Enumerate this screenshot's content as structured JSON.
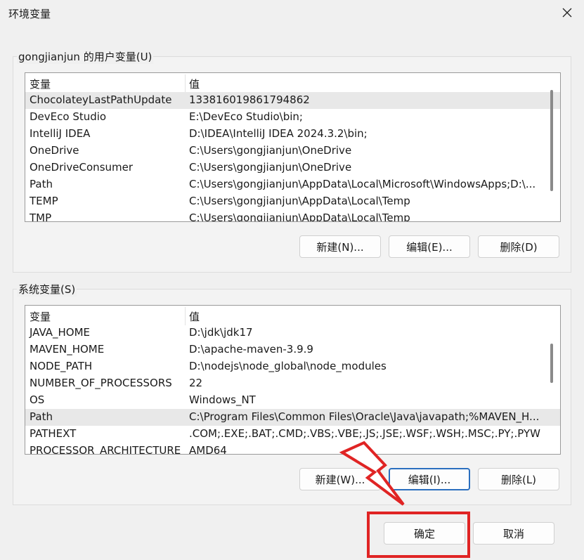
{
  "window": {
    "title": "环境变量"
  },
  "user_vars": {
    "group_label": "gongjianjun 的用户变量(U)",
    "header": {
      "name": "变量",
      "value": "值"
    },
    "rows": [
      {
        "name": "ChocolateyLastPathUpdate",
        "value": "133816019861794862"
      },
      {
        "name": "DevEco Studio",
        "value": "E:\\DevEco Studio\\bin;"
      },
      {
        "name": "IntelliJ IDEA",
        "value": "D:\\IDEA\\IntelliJ IDEA 2024.3.2\\bin;"
      },
      {
        "name": "OneDrive",
        "value": "C:\\Users\\gongjianjun\\OneDrive"
      },
      {
        "name": "OneDriveConsumer",
        "value": "C:\\Users\\gongjianjun\\OneDrive"
      },
      {
        "name": "Path",
        "value": "C:\\Users\\gongjianjun\\AppData\\Local\\Microsoft\\WindowsApps;D:\\..."
      },
      {
        "name": "TEMP",
        "value": "C:\\Users\\gongjianjun\\AppData\\Local\\Temp"
      },
      {
        "name": "TMP",
        "value": "C:\\Users\\gongjianjun\\AppData\\Local\\Temp"
      }
    ],
    "buttons": {
      "new": "新建(N)...",
      "edit": "编辑(E)...",
      "delete": "删除(D)"
    }
  },
  "system_vars": {
    "group_label": "系统变量(S)",
    "header": {
      "name": "变量",
      "value": "值"
    },
    "rows": [
      {
        "name": "JAVA_HOME",
        "value": "D:\\jdk\\jdk17"
      },
      {
        "name": "MAVEN_HOME",
        "value": "D:\\apache-maven-3.9.9"
      },
      {
        "name": "NODE_PATH",
        "value": "D:\\nodejs\\node_global\\node_modules"
      },
      {
        "name": "NUMBER_OF_PROCESSORS",
        "value": "22"
      },
      {
        "name": "OS",
        "value": "Windows_NT"
      },
      {
        "name": "Path",
        "value": "C:\\Program Files\\Common Files\\Oracle\\Java\\javapath;%MAVEN_H..."
      },
      {
        "name": "PATHEXT",
        "value": ".COM;.EXE;.BAT;.CMD;.VBS;.VBE;.JS;.JSE;.WSF;.WSH;.MSC;.PY;.PYW"
      },
      {
        "name": "PROCESSOR_ARCHITECTURE",
        "value": "AMD64"
      }
    ],
    "buttons": {
      "new": "新建(W)...",
      "edit": "编辑(I)...",
      "delete": "删除(L)"
    }
  },
  "footer": {
    "ok": "确定",
    "cancel": "取消"
  },
  "colors": {
    "annotation": "#e02424",
    "focus_border": "#2b6fbf",
    "selected_row": "#e8e8e8"
  },
  "selection": {
    "user_selected_index": 0,
    "system_selected_index": 5
  }
}
